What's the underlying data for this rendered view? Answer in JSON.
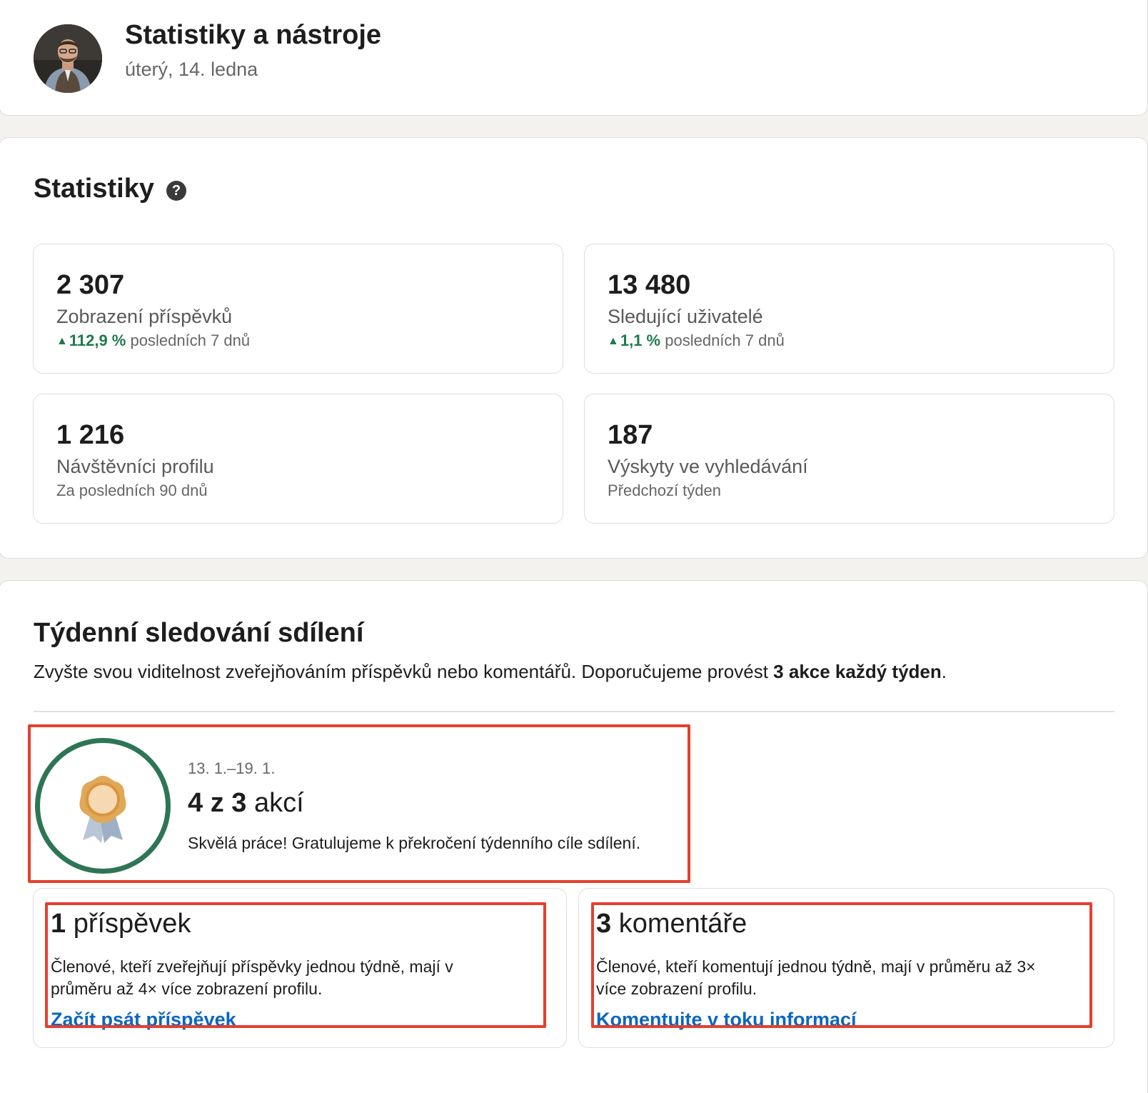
{
  "header": {
    "title": "Statistiky a nástroje",
    "date": "úterý, 14. ledna"
  },
  "stats": {
    "title": "Statistiky",
    "help_icon": "?",
    "tiles": [
      {
        "value": "2 307",
        "label": "Zobrazení příspěvků",
        "trend": "112,9 %",
        "trend_dir": "up",
        "sub": "posledních 7 dnů"
      },
      {
        "value": "13 480",
        "label": "Sledující uživatelé",
        "trend": "1,1 %",
        "trend_dir": "up",
        "sub": "posledních 7 dnů"
      },
      {
        "value": "1 216",
        "label": "Návštěvníci profilu",
        "sub": "Za posledních 90 dnů"
      },
      {
        "value": "187",
        "label": "Výskyty ve vyhledávání",
        "sub": "Předchozí týden"
      }
    ],
    "trend_color": "#1e7a4c"
  },
  "weekly": {
    "title": "Týdenní sledování sdílení",
    "desc_prefix": "Zvyšte svou viditelnost zveřejňováním příspěvků nebo komentářů. Doporučujeme provést ",
    "desc_bold": "3 akce každý týden",
    "desc_suffix": ".",
    "range": "13. 1.–19. 1.",
    "count_num": "4 z 3",
    "count_unit": " akcí",
    "message": "Skvělá práce! Gratulujeme k překročení týdenního cíle sdílení.",
    "badge_icon": "award-ribbon-icon",
    "ring_color": "#2e7554",
    "highlight_color": "#e4402d",
    "actions": [
      {
        "num": "1",
        "unit": " příspěvek",
        "desc": "Členové, kteří zveřejňují příspěvky jednou týdně, mají v průměru až 4× více zobrazení profilu.",
        "link": "Začít psát příspěvek"
      },
      {
        "num": "3",
        "unit": " komentáře",
        "desc": "Členové, kteří komentují jednou týdně, mají v průměru až 3× více zobrazení profilu.",
        "link": "Komentujte v toku informací"
      }
    ]
  }
}
